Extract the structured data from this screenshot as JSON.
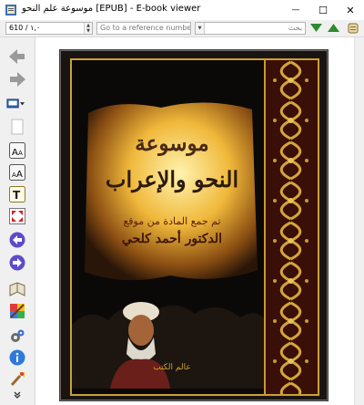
{
  "window": {
    "title": "موسوعة علم النحو [EPUB] - E-book viewer",
    "minimize_glyph": "—",
    "maximize_glyph": "☐",
    "close_glyph": "✕"
  },
  "toolbar": {
    "position_value": "610 / ١,٠",
    "reference_placeholder": "Go to a reference number...",
    "search_placeholder": "بحث"
  },
  "book": {
    "title_line1": "موسوعة",
    "title_line2": "النحو والإعراب",
    "subtitle_line1": "تم جمع المادة من موقع",
    "subtitle_line2": "الدكتور أحمد كلحي",
    "publisher_mark": "عالم الكتب"
  },
  "colors": {
    "accent_green": "#2e8b2e",
    "frame_gold": "#caa135",
    "nav_purple": "#5d4bc7"
  },
  "icons": [
    "back-icon",
    "forward-icon",
    "library-icon",
    "copy-icon",
    "font-larger-icon",
    "font-smaller-icon",
    "text-icon",
    "fullscreen-icon",
    "previous-page-icon",
    "next-page-icon",
    "bookmark-icon",
    "theme-icon",
    "preferences-icon",
    "info-icon",
    "tools-icon"
  ]
}
